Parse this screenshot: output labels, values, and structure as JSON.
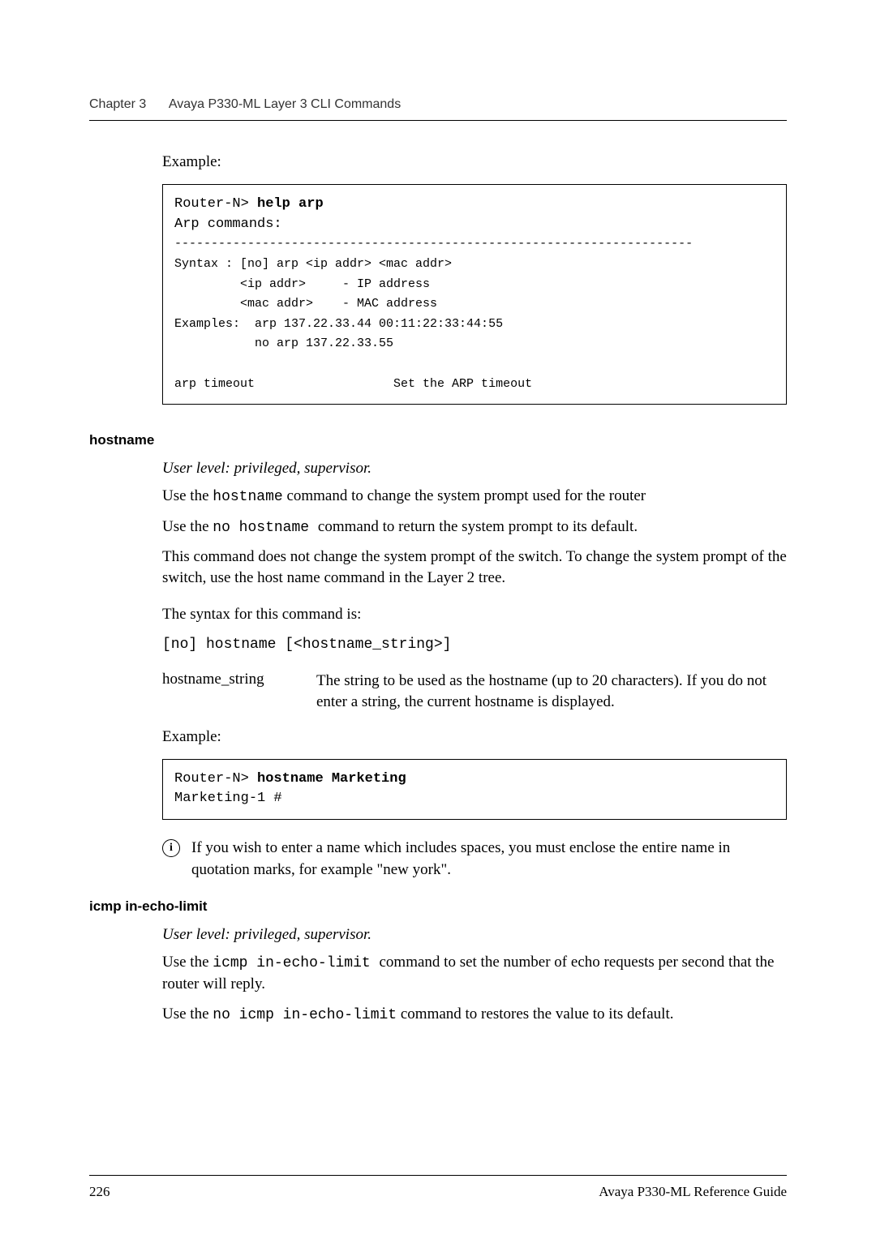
{
  "header": {
    "chapter_label": "Chapter 3",
    "chapter_title": "Avaya P330-ML Layer 3 CLI Commands"
  },
  "example1": {
    "label": "Example:",
    "prompt": "Router-N> ",
    "cmd": "help arp",
    "resp1": "Arp commands:",
    "dashes": "-----------------------------------------------------------------------",
    "syntax_l1": "Syntax : [no] arp <ip addr> <mac addr>",
    "syntax_l2": "         <ip addr>     - IP address",
    "syntax_l3": "         <mac addr>    - MAC address",
    "ex_l1": "Examples:  arp 137.22.33.44 00:11:22:33:44:55",
    "ex_l2": "           no arp 137.22.33.55",
    "tail": "arp timeout                   Set the ARP timeout"
  },
  "hostname": {
    "heading": "hostname",
    "user_level": "User level: privileged, supervisor.",
    "p1_a": "Use the ",
    "p1_code": "hostname",
    "p1_b": " command to change the system prompt used for the router",
    "p2_a": "Use the ",
    "p2_code": " no hostname ",
    "p2_b": " command to return the system prompt to its default.",
    "p3": "This command does not change the system prompt of the switch. To change the system prompt of the switch, use the host name command in the Layer 2 tree.",
    "syntax_label": "The syntax for this command is:",
    "syntax_code": "[no] hostname [<hostname_string>]",
    "param_name": "hostname_string",
    "param_desc": "The string to be used as the hostname (up to 20 characters). If you do not enter a string, the current hostname is displayed.",
    "example_label": "Example:",
    "ex_prompt": "Router-N> ",
    "ex_cmd": "hostname Marketing",
    "ex_out": "Marketing-1 #",
    "note": "If you wish to enter a name which includes spaces, you must enclose the entire name in quotation marks, for example \"new york\"."
  },
  "icmp": {
    "heading": "icmp in-echo-limit",
    "user_level": "User level: privileged, supervisor.",
    "p1_a": "Use the ",
    "p1_code": "icmp in-echo-limit ",
    "p1_b": " command to set the number of echo requests per second that the router will reply.",
    "p2_a": "Use the ",
    "p2_code": "no icmp in-echo-limit",
    "p2_b": " command to restores the value to its default."
  },
  "footer": {
    "page_number": "226",
    "doc_title": "Avaya P330-ML Reference Guide"
  }
}
